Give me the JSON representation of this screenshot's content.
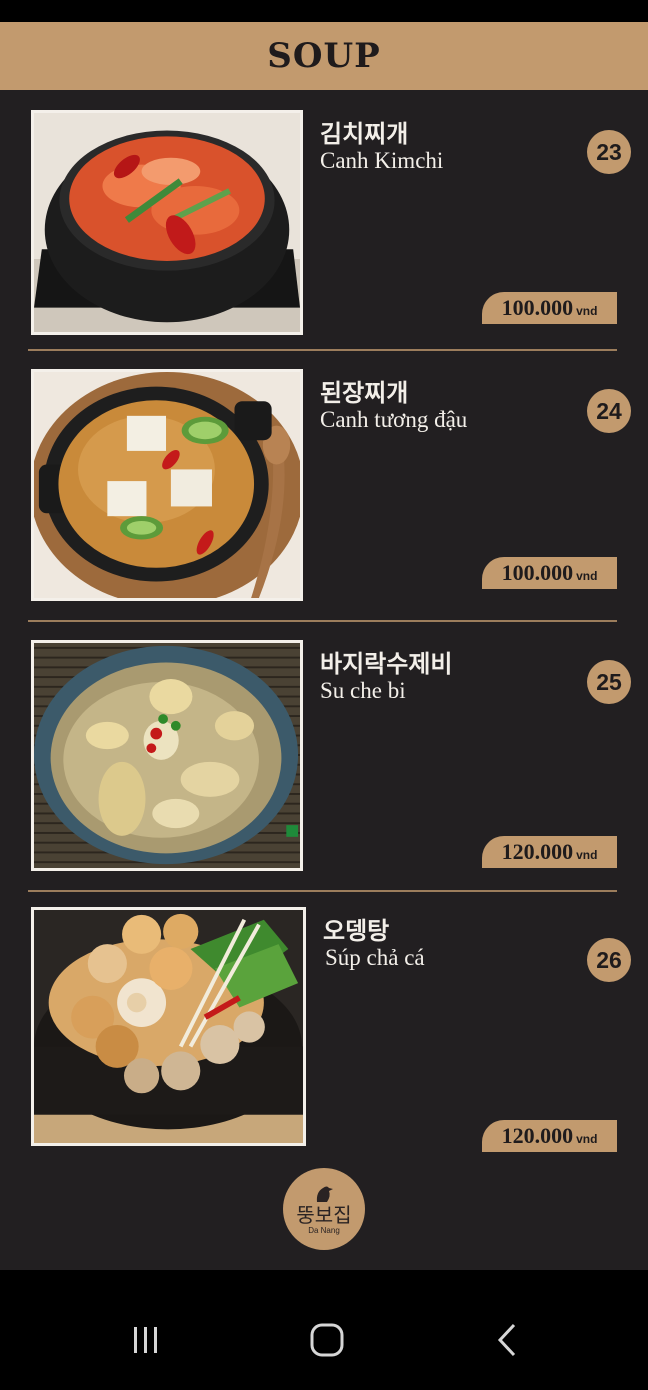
{
  "header": {
    "title": "SOUP"
  },
  "items": [
    {
      "kr": "김치찌개",
      "vn": "Canh Kimchi",
      "number": "23",
      "price": "100.000",
      "currency": "vnd",
      "image": "kimchi-stew-photo"
    },
    {
      "kr": "된장찌개",
      "vn": "Canh tương đậu",
      "number": "24",
      "price": "100.000",
      "currency": "vnd",
      "image": "soybean-paste-stew-photo"
    },
    {
      "kr": "바지락수제비",
      "vn": "Su che bi",
      "number": "25",
      "price": "120.000",
      "currency": "vnd",
      "image": "clam-sujebi-photo"
    },
    {
      "kr": "오뎅탕",
      "vn": "Súp chả cá",
      "number": "26",
      "price": "120.000",
      "currency": "vnd",
      "image": "fish-cake-soup-photo"
    }
  ],
  "logo": {
    "kr": "뚱보집",
    "sub": "Da Nang"
  },
  "colors": {
    "background": "#221f21",
    "accent": "#c29a6e",
    "text": "#f3efe9"
  },
  "navigation": {
    "buttons": [
      "recent-apps-icon",
      "home-icon",
      "back-icon"
    ]
  }
}
